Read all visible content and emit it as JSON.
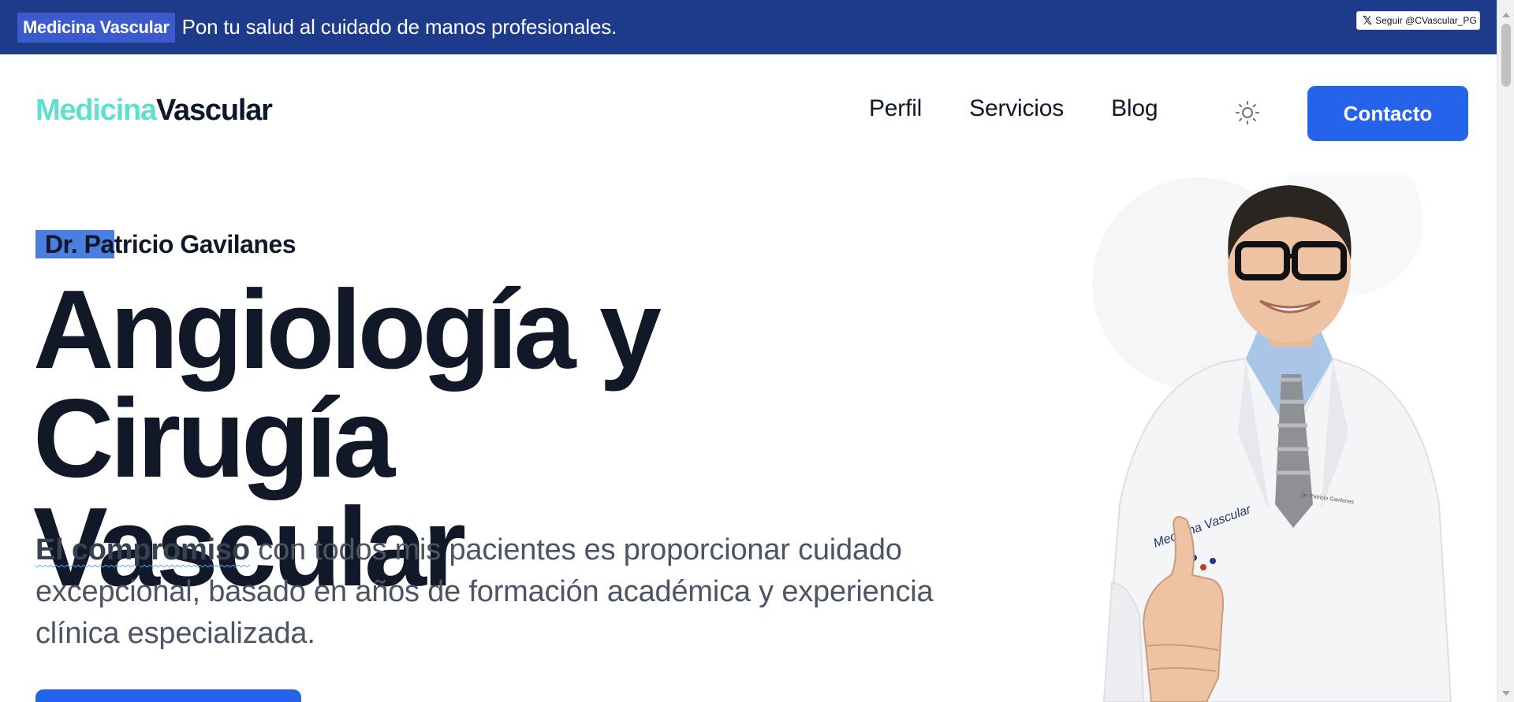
{
  "topbar": {
    "brand_chip": "Medicina Vascular",
    "tagline": "Pon tu salud al cuidado de manos profesionales.",
    "follow_button": "Seguir @CVascular_PG",
    "follow_icon": "x-logo-icon"
  },
  "navbar": {
    "logo_part1": "Medicina",
    "logo_part2": "Vascular",
    "links": [
      "Perfil",
      "Servicios",
      "Blog"
    ],
    "theme_toggle_icon": "sun-icon",
    "contact_label": "Contacto"
  },
  "hero": {
    "eyebrow_selected": "Dr. Pa",
    "eyebrow_rest": "tricio Gavilanes",
    "title_line1": "Angiología y Cirugía",
    "title_line2": "Vascular",
    "desc_highlight": "El compromiso",
    "desc_rest": " con todos mis pacientes es proporcionar cuidado excepcional, basado en años de formación académica y experiencia clínica especializada.",
    "coat_logo_text": "Medicina Vascular"
  },
  "colors": {
    "topbar_bg": "#1e3a8a",
    "accent_blue": "#2563eb",
    "logo_teal": "#5fe0cf",
    "text_dark": "#111827",
    "text_muted": "#4b5563"
  }
}
